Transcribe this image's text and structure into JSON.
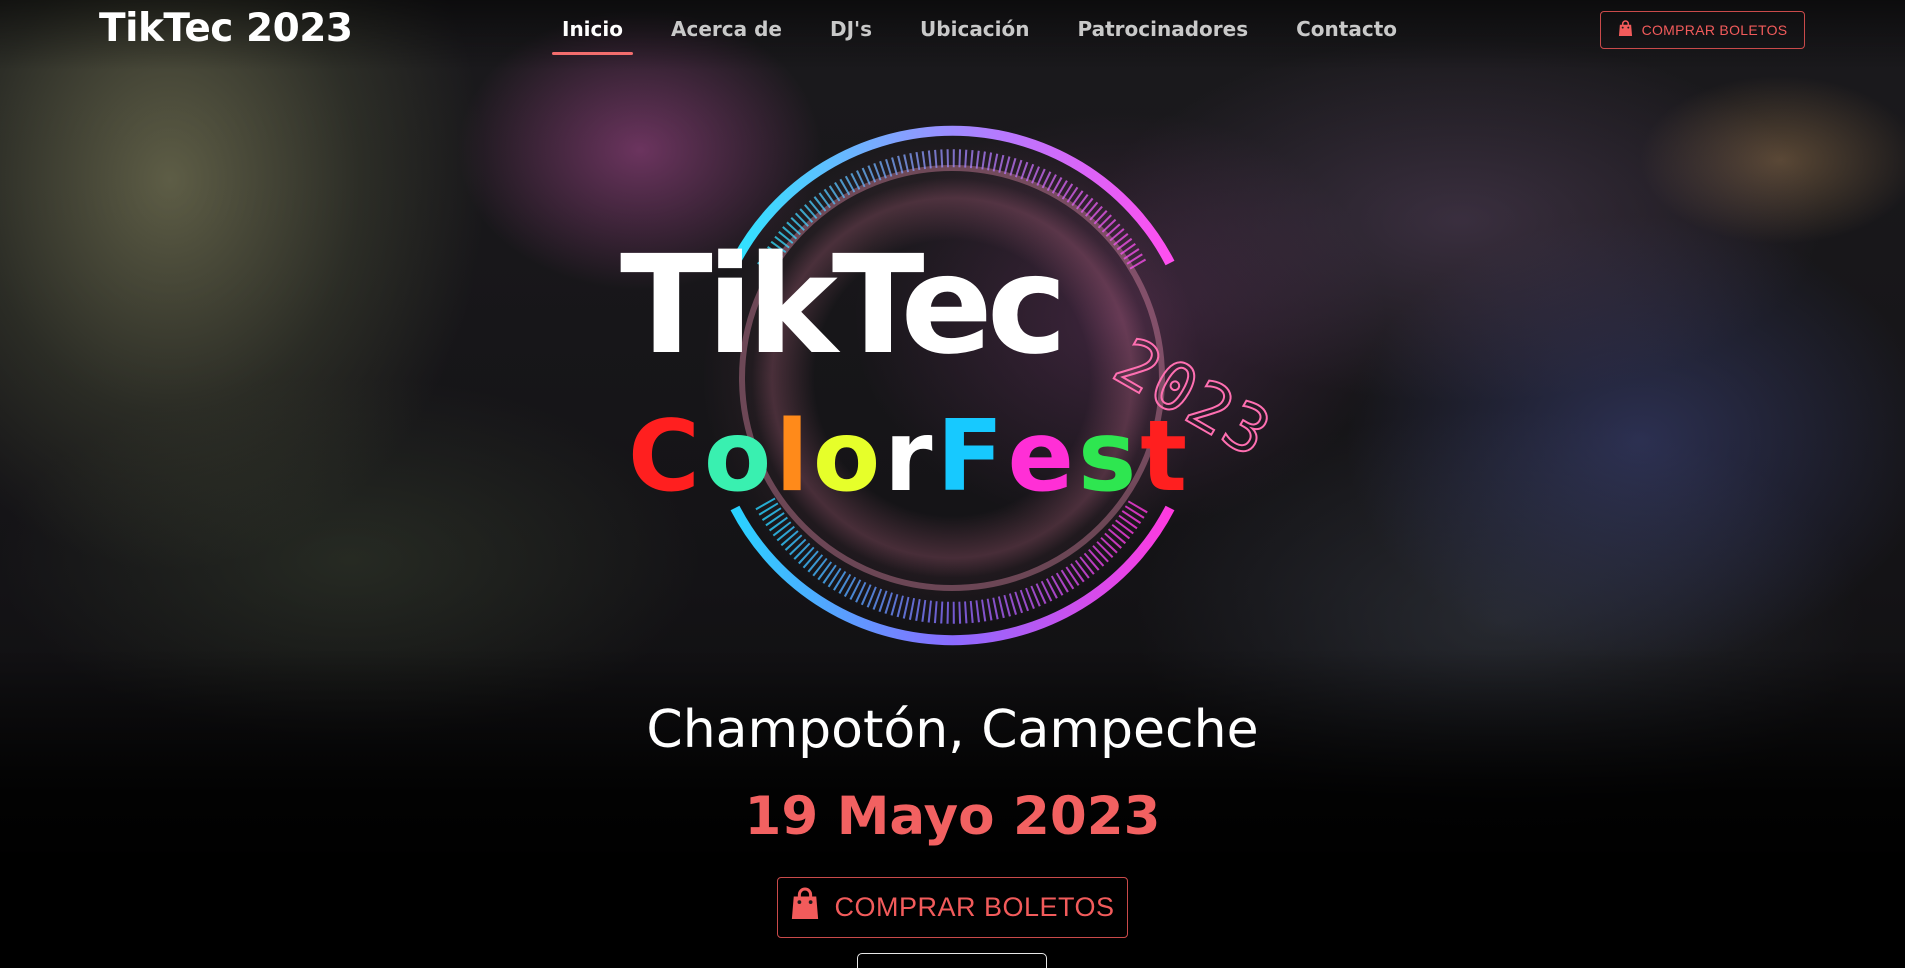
{
  "navbar": {
    "brand": "TikTec 2023",
    "links": [
      {
        "label": "Inicio",
        "active": true
      },
      {
        "label": "Acerca de",
        "active": false
      },
      {
        "label": "DJ's",
        "active": false
      },
      {
        "label": "Ubicación",
        "active": false
      },
      {
        "label": "Patrocinadores",
        "active": false
      },
      {
        "label": "Contacto",
        "active": false
      }
    ],
    "cta_label": "COMPRAR BOLETOS",
    "cta_icon": "shopping-bag-icon"
  },
  "hero": {
    "logo": {
      "word": "TikTec",
      "year": "2023",
      "subtitle": "Color Fest",
      "subtitle_colors": [
        "#ff1f1f",
        "#39f0b0",
        "#ff8a1a",
        "#e6ff2a",
        "#000000",
        "#1fe87a",
        "#17c9ff",
        "#ff2fd6",
        "#2ee650"
      ]
    },
    "location": "Champotón, Campeche",
    "date": "19 Mayo 2023",
    "cta_label": "COMPRAR BOLETOS",
    "cta_icon": "shopping-bag-icon"
  },
  "colors": {
    "accent": "#f26161",
    "active_underline": "#f26d6d",
    "nav_text": "#c9c9c9"
  }
}
